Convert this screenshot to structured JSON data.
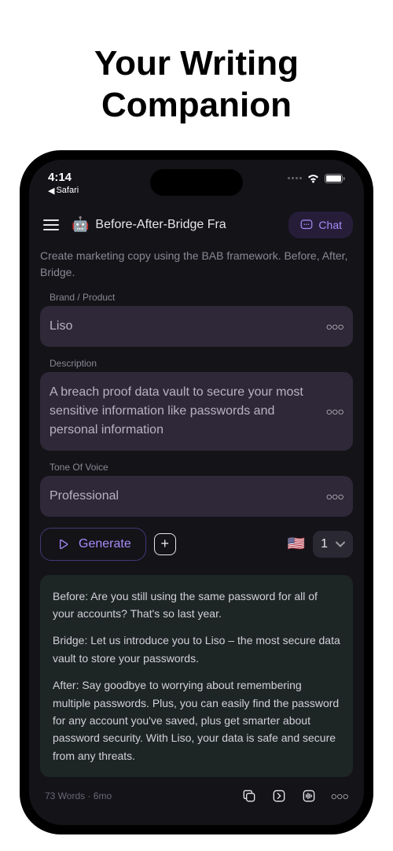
{
  "headline": "Your Writing Companion",
  "status": {
    "time": "4:14",
    "back_label": "Safari"
  },
  "header": {
    "title": "Before-After-Bridge Fra",
    "chat_button": "Chat"
  },
  "intro": "Create marketing copy using the BAB framework. Before, After, Bridge.",
  "fields": {
    "brand": {
      "label": "Brand / Product",
      "value": "Liso"
    },
    "description": {
      "label": "Description",
      "value": "A breach proof data vault to secure your most sensitive information like passwords and personal information"
    },
    "tone": {
      "label": "Tone Of Voice",
      "value": "Professional"
    }
  },
  "actions": {
    "generate": "Generate",
    "count": "1"
  },
  "output": {
    "before": "Before: Are you still using the same password for all of your accounts? That's so last year.",
    "bridge": "Bridge: Let us introduce you to Liso – the most secure data vault to store your passwords.",
    "after": "After: Say goodbye to worrying about remembering multiple passwords. Plus, you can easily find the password for any account you've saved, plus get smarter about password security. With Liso, your data is safe and secure from any threats."
  },
  "output_meta": "73 Words · 6mo"
}
